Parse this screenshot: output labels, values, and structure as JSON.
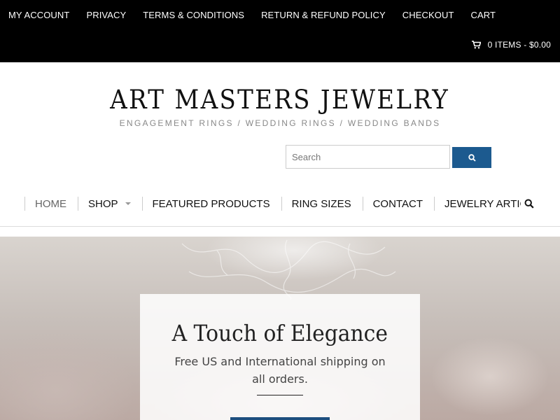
{
  "topbar": {
    "links": [
      "MY ACCOUNT",
      "PRIVACY",
      "TERMS & CONDITIONS",
      "RETURN & REFUND POLICY",
      "CHECKOUT",
      "CART"
    ],
    "cart_summary": "0 ITEMS - $0.00",
    "cart_icon": "shopping-cart-icon"
  },
  "header": {
    "title": "ART MASTERS JEWELRY",
    "tagline": "ENGAGEMENT RINGS / WEDDING RINGS / WEDDING BANDS"
  },
  "search": {
    "placeholder": "Search",
    "value": "",
    "button_icon": "search-icon"
  },
  "nav": {
    "items": [
      "HOME",
      "SHOP",
      "FEATURED PRODUCTS",
      "RING SIZES",
      "CONTACT",
      "JEWELRY ARTICLES"
    ],
    "search_icon": "search-icon"
  },
  "hero": {
    "title": "A Touch of Elegance",
    "subtitle": "Free US and International shipping on all orders."
  },
  "colors": {
    "topbar_bg": "#000000",
    "accent": "#1c5a8f",
    "hero_button": "#1c4e7e"
  }
}
